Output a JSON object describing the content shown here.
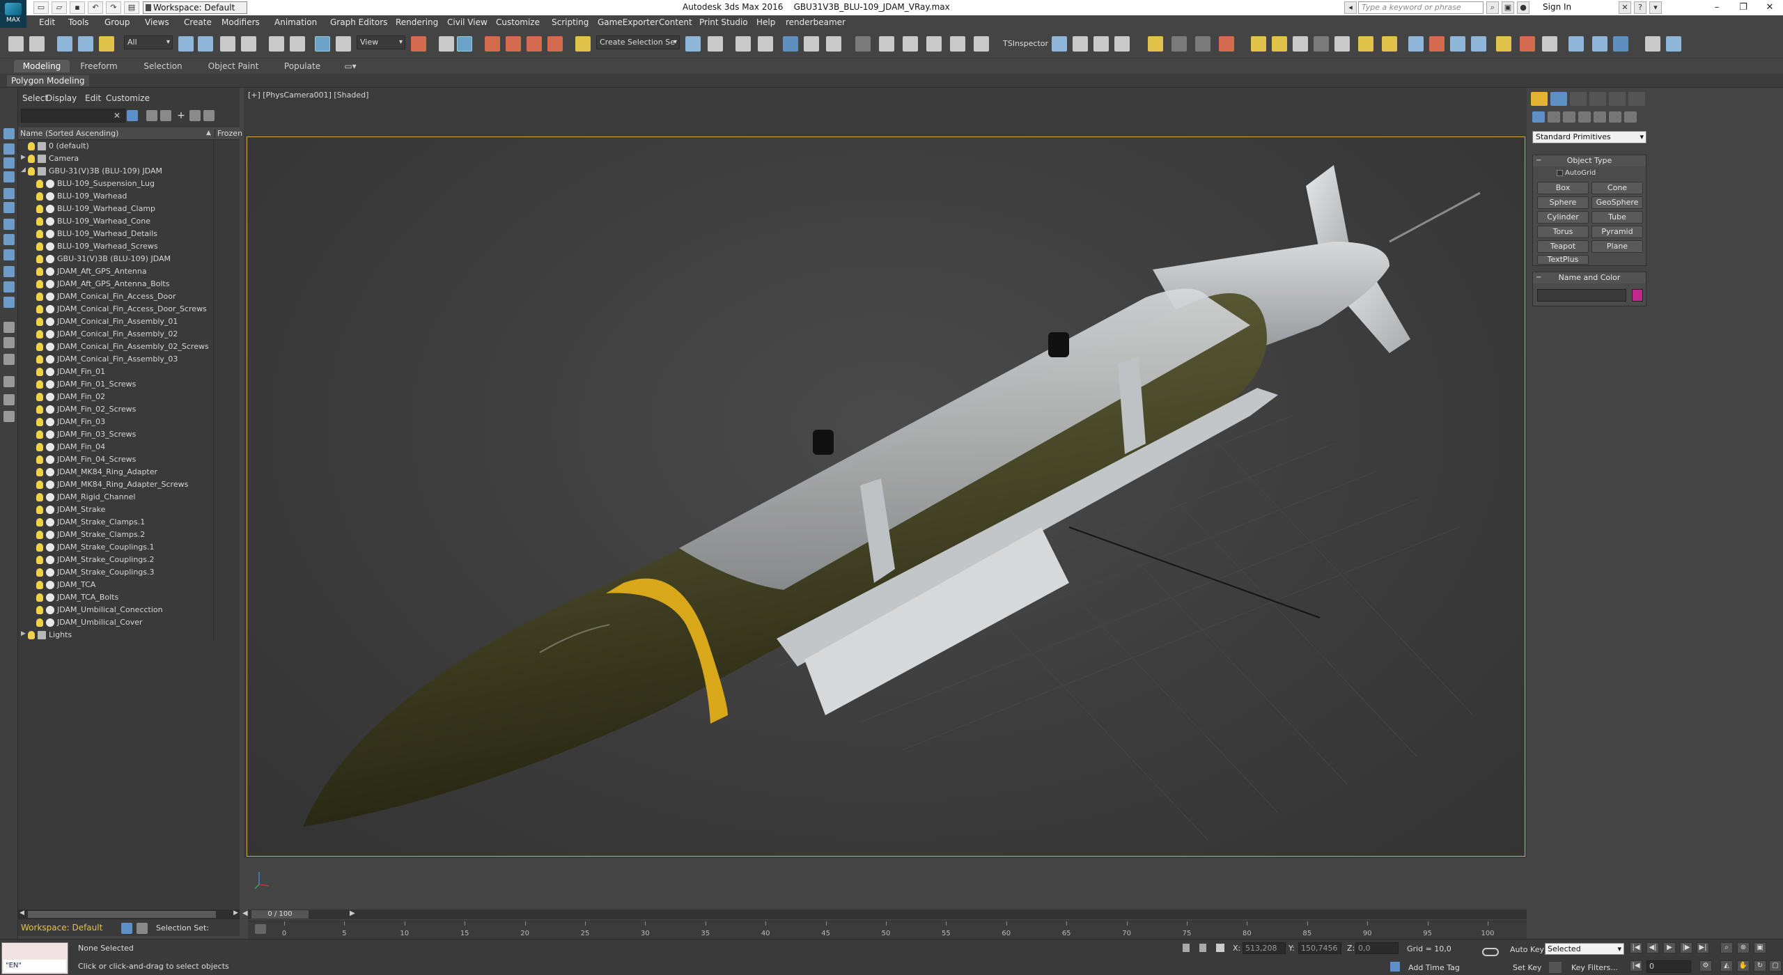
{
  "titlebar": {
    "app_name": "Autodesk 3ds Max 2016",
    "file_name": "GBU31V3B_BLU-109_JDAM_VRay.max",
    "workspace": "Workspace: Default",
    "search_placeholder": "Type a keyword or phrase",
    "sign_in": "Sign In",
    "logo_text": "MAX"
  },
  "menu": [
    "Edit",
    "Tools",
    "Group",
    "Views",
    "Create",
    "Modifiers",
    "Animation",
    "Graph Editors",
    "Rendering",
    "Civil View",
    "Customize",
    "Scripting",
    "GameExporter",
    "Content",
    "Print Studio",
    "Help",
    "renderbeamer"
  ],
  "toolbar": {
    "selection_filter": "All",
    "ref_coord": "View",
    "named_selection": "Create Selection Se",
    "tsinspector": "TSInspector"
  },
  "ribbon": {
    "tabs": [
      "Modeling",
      "Freeform",
      "Selection",
      "Object Paint",
      "Populate"
    ],
    "active_tab": "Modeling",
    "sub_label": "Polygon Modeling"
  },
  "scene_explorer": {
    "menu": [
      "Select",
      "Display",
      "Edit",
      "Customize"
    ],
    "col_name": "Name (Sorted Ascending)",
    "col_frozen": "Frozen",
    "rows": [
      {
        "label": "0 (default)",
        "indent": 1,
        "kind": "layer",
        "expander": ""
      },
      {
        "label": "Camera",
        "indent": 1,
        "kind": "layer",
        "expander": "▶"
      },
      {
        "label": "GBU-31(V)3B (BLU-109) JDAM",
        "indent": 1,
        "kind": "layer",
        "expander": "◢"
      },
      {
        "label": "BLU-109_Suspension_Lug",
        "indent": 2,
        "kind": "obj",
        "expander": ""
      },
      {
        "label": "BLU-109_Warhead",
        "indent": 2,
        "kind": "obj",
        "expander": ""
      },
      {
        "label": "BLU-109_Warhead_Clamp",
        "indent": 2,
        "kind": "obj",
        "expander": ""
      },
      {
        "label": "BLU-109_Warhead_Cone",
        "indent": 2,
        "kind": "obj",
        "expander": ""
      },
      {
        "label": "BLU-109_Warhead_Details",
        "indent": 2,
        "kind": "obj",
        "expander": ""
      },
      {
        "label": "BLU-109_Warhead_Screws",
        "indent": 2,
        "kind": "obj",
        "expander": ""
      },
      {
        "label": "GBU-31(V)3B (BLU-109) JDAM",
        "indent": 2,
        "kind": "group",
        "expander": ""
      },
      {
        "label": "JDAM_Aft_GPS_Antenna",
        "indent": 2,
        "kind": "obj",
        "expander": ""
      },
      {
        "label": "JDAM_Aft_GPS_Antenna_Bolts",
        "indent": 2,
        "kind": "obj",
        "expander": ""
      },
      {
        "label": "JDAM_Conical_Fin_Access_Door",
        "indent": 2,
        "kind": "obj",
        "expander": ""
      },
      {
        "label": "JDAM_Conical_Fin_Access_Door_Screws",
        "indent": 2,
        "kind": "obj",
        "expander": ""
      },
      {
        "label": "JDAM_Conical_Fin_Assembly_01",
        "indent": 2,
        "kind": "obj",
        "expander": ""
      },
      {
        "label": "JDAM_Conical_Fin_Assembly_02",
        "indent": 2,
        "kind": "obj",
        "expander": ""
      },
      {
        "label": "JDAM_Conical_Fin_Assembly_02_Screws",
        "indent": 2,
        "kind": "obj",
        "expander": ""
      },
      {
        "label": "JDAM_Conical_Fin_Assembly_03",
        "indent": 2,
        "kind": "obj",
        "expander": ""
      },
      {
        "label": "JDAM_Fin_01",
        "indent": 2,
        "kind": "obj",
        "expander": ""
      },
      {
        "label": "JDAM_Fin_01_Screws",
        "indent": 2,
        "kind": "obj",
        "expander": ""
      },
      {
        "label": "JDAM_Fin_02",
        "indent": 2,
        "kind": "obj",
        "expander": ""
      },
      {
        "label": "JDAM_Fin_02_Screws",
        "indent": 2,
        "kind": "obj",
        "expander": ""
      },
      {
        "label": "JDAM_Fin_03",
        "indent": 2,
        "kind": "obj",
        "expander": ""
      },
      {
        "label": "JDAM_Fin_03_Screws",
        "indent": 2,
        "kind": "obj",
        "expander": ""
      },
      {
        "label": "JDAM_Fin_04",
        "indent": 2,
        "kind": "obj",
        "expander": ""
      },
      {
        "label": "JDAM_Fin_04_Screws",
        "indent": 2,
        "kind": "obj",
        "expander": ""
      },
      {
        "label": "JDAM_MK84_Ring_Adapter",
        "indent": 2,
        "kind": "obj",
        "expander": ""
      },
      {
        "label": "JDAM_MK84_Ring_Adapter_Screws",
        "indent": 2,
        "kind": "obj",
        "expander": ""
      },
      {
        "label": "JDAM_Rigid_Channel",
        "indent": 2,
        "kind": "obj",
        "expander": ""
      },
      {
        "label": "JDAM_Strake",
        "indent": 2,
        "kind": "obj",
        "expander": ""
      },
      {
        "label": "JDAM_Strake_Clamps.1",
        "indent": 2,
        "kind": "obj",
        "expander": ""
      },
      {
        "label": "JDAM_Strake_Clamps.2",
        "indent": 2,
        "kind": "obj",
        "expander": ""
      },
      {
        "label": "JDAM_Strake_Couplings.1",
        "indent": 2,
        "kind": "obj",
        "expander": ""
      },
      {
        "label": "JDAM_Strake_Couplings.2",
        "indent": 2,
        "kind": "obj",
        "expander": ""
      },
      {
        "label": "JDAM_Strake_Couplings.3",
        "indent": 2,
        "kind": "obj",
        "expander": ""
      },
      {
        "label": "JDAM_TCA",
        "indent": 2,
        "kind": "obj",
        "expander": ""
      },
      {
        "label": "JDAM_TCA_Bolts",
        "indent": 2,
        "kind": "obj",
        "expander": ""
      },
      {
        "label": "JDAM_Umbilical_Conecction",
        "indent": 2,
        "kind": "obj",
        "expander": ""
      },
      {
        "label": "JDAM_Umbilical_Cover",
        "indent": 2,
        "kind": "obj",
        "expander": ""
      },
      {
        "label": "Lights",
        "indent": 1,
        "kind": "layer",
        "expander": "▶"
      }
    ],
    "workspace": "Workspace: Default",
    "selection_set": "Selection Set:"
  },
  "viewport": {
    "label": "[+] [PhysCamera001] [Shaded]",
    "frame_counter": "0 / 100"
  },
  "timeline": {
    "ticks": [
      "0",
      "5",
      "10",
      "15",
      "20",
      "25",
      "30",
      "35",
      "40",
      "45",
      "50",
      "55",
      "60",
      "65",
      "70",
      "75",
      "80",
      "85",
      "90",
      "95",
      "100"
    ]
  },
  "status": {
    "selection": "None Selected",
    "prompt": "Click or click-and-drag to select objects",
    "maxscript_lang": "\"EN\"",
    "x_label": "X:",
    "x_value": "513,208",
    "y_label": "Y:",
    "y_value": "150,7456",
    "z_label": "Z:",
    "z_value": "0,0",
    "grid": "Grid = 10,0",
    "add_time_tag": "Add Time Tag",
    "auto_key": "Auto Key",
    "set_key": "Set Key",
    "key_mode": "Selected",
    "key_filters": "Key Filters...",
    "frame": "0"
  },
  "command_panel": {
    "category": "Standard Primitives",
    "object_type_title": "Object Type",
    "autogrid": "AutoGrid",
    "buttons": [
      "Box",
      "Cone",
      "Sphere",
      "GeoSphere",
      "Cylinder",
      "Tube",
      "Torus",
      "Pyramid",
      "Teapot",
      "Plane",
      "TextPlus"
    ],
    "name_color_title": "Name and Color",
    "object_color": "#c4288c"
  },
  "colors": {
    "viewport_border": "#c8ad3c",
    "bomb_body": "#4b4a2a",
    "bomb_band": "#d8a71a",
    "jdam_gray": "#b9bcbe"
  }
}
